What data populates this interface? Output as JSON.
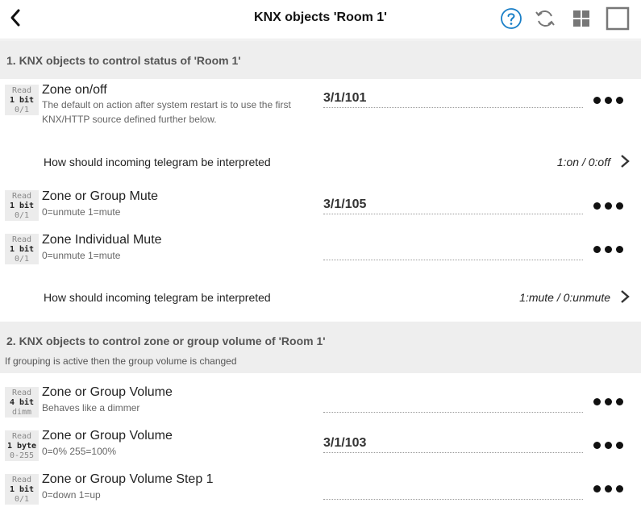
{
  "header": {
    "title": "KNX objects 'Room 1'",
    "icons": [
      "back-arrow-icon",
      "help-icon",
      "refresh-icon",
      "grid-icon",
      "square-icon"
    ],
    "accent_color": "#1a7fc7"
  },
  "sections": [
    {
      "title": "1. KNX objects to control status of 'Room 1'",
      "subtitle": "",
      "rows": [
        {
          "type": [
            "Read",
            "1 bit",
            "0/1"
          ],
          "title": "Zone on/off",
          "desc": [
            "The default on action after system restart is to use the first",
            "KNX/HTTP source defined further below."
          ],
          "address": "3/1/101"
        },
        {
          "interp_label": "How should incoming telegram be interpreted",
          "interp_value": "1:on / 0:off"
        },
        {
          "type": [
            "Read",
            "1 bit",
            "0/1"
          ],
          "title": "Zone or Group Mute",
          "desc": [
            "0=unmute 1=mute"
          ],
          "address": "3/1/105"
        },
        {
          "type": [
            "Read",
            "1 bit",
            "0/1"
          ],
          "title": "Zone Individual Mute",
          "desc": [
            "0=unmute 1=mute"
          ],
          "address": ""
        },
        {
          "interp_label": "How should incoming telegram be interpreted",
          "interp_value": "1:mute / 0:unmute"
        }
      ]
    },
    {
      "title": "2. KNX objects to control zone or group volume of 'Room 1'",
      "subtitle": "If grouping is active then the group volume is changed",
      "rows": [
        {
          "type": [
            "Read",
            "4 bit",
            "dimm"
          ],
          "title": "Zone or Group Volume",
          "desc": [
            "Behaves like a dimmer"
          ],
          "address": ""
        },
        {
          "type": [
            "Read",
            "1 byte",
            "0-255"
          ],
          "title": "Zone or Group Volume",
          "desc": [
            "0=0% 255=100%"
          ],
          "address": "3/1/103"
        },
        {
          "type": [
            "Read",
            "1 bit",
            "0/1"
          ],
          "title": "Zone or Group Volume Step 1",
          "desc": [
            "0=down 1=up"
          ],
          "address": ""
        }
      ]
    }
  ]
}
